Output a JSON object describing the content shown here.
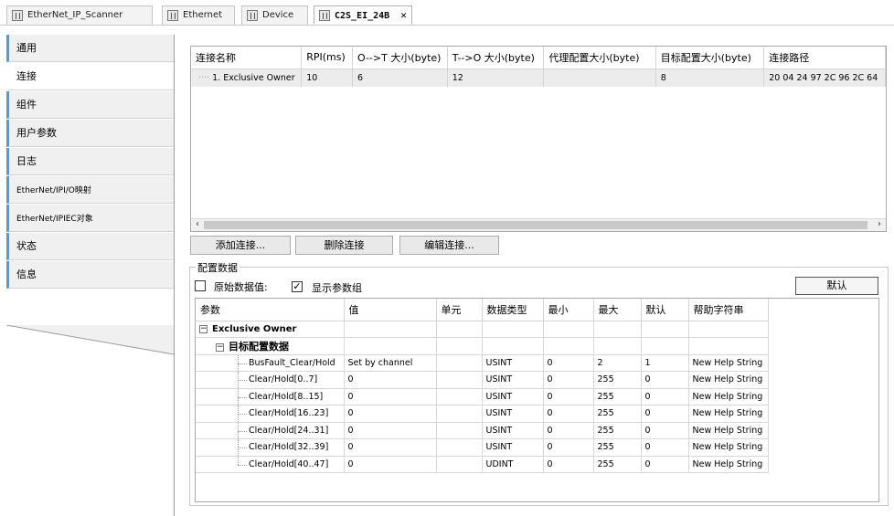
{
  "tabs": [
    {
      "label": "EtherNet_IP_Scanner",
      "active": false
    },
    {
      "label": "Ethernet",
      "active": false
    },
    {
      "label": "Device",
      "active": false
    },
    {
      "label": "C2S_EI_24B",
      "active": true
    }
  ],
  "nav": {
    "items": [
      {
        "label": "通用",
        "selected": false
      },
      {
        "label": "连接",
        "selected": true
      },
      {
        "label": "组件",
        "selected": false
      },
      {
        "label": "用户参数",
        "selected": false
      },
      {
        "label": "日志",
        "selected": false
      },
      {
        "label": "EtherNet/IPI/O映射",
        "selected": false
      },
      {
        "label": "EtherNet/IPIEC对象",
        "selected": false
      },
      {
        "label": "状态",
        "selected": false
      },
      {
        "label": "信息",
        "selected": false
      }
    ],
    "accent_color": "#4a9fe0"
  },
  "connections": {
    "headers": [
      "连接名称",
      "RPI(ms)",
      "O-->T 大小(byte)",
      "T-->O 大小(byte)",
      "代理配置大小(byte)",
      "目标配置大小(byte)",
      "连接路径"
    ],
    "rows": [
      [
        "1. Exclusive Owner",
        "10",
        "6",
        "12",
        "",
        "8",
        "20 04 24 97 2C 96 2C 64"
      ]
    ]
  },
  "buttons": {
    "add": "添加连接...",
    "delete": "删除连接",
    "edit": "编辑连接..."
  },
  "config": {
    "group_label": "配置数据",
    "raw_values_label": "原始数据值:",
    "raw_values_checked": false,
    "show_groups_label": "显示参数组",
    "show_groups_checked": true,
    "default_button": "默认",
    "headers": [
      "参数",
      "值",
      "单元",
      "数据类型",
      "最小",
      "最大",
      "默认",
      "帮助字符串"
    ],
    "group1": "Exclusive Owner",
    "group2": "目标配置数据",
    "rows": [
      {
        "param": "BusFault_Clear/Hold",
        "value": "Set by channel",
        "unit": "",
        "type": "USINT",
        "min": "0",
        "max": "2",
        "def": "1",
        "help": "New Help String"
      },
      {
        "param": "Clear/Hold[0..7]",
        "value": "0",
        "unit": "",
        "type": "USINT",
        "min": "0",
        "max": "255",
        "def": "0",
        "help": "New Help String"
      },
      {
        "param": "Clear/Hold[8..15]",
        "value": "0",
        "unit": "",
        "type": "USINT",
        "min": "0",
        "max": "255",
        "def": "0",
        "help": "New Help String"
      },
      {
        "param": "Clear/Hold[16..23]",
        "value": "0",
        "unit": "",
        "type": "USINT",
        "min": "0",
        "max": "255",
        "def": "0",
        "help": "New Help String"
      },
      {
        "param": "Clear/Hold[24..31]",
        "value": "0",
        "unit": "",
        "type": "USINT",
        "min": "0",
        "max": "255",
        "def": "0",
        "help": "New Help String"
      },
      {
        "param": "Clear/Hold[32..39]",
        "value": "0",
        "unit": "",
        "type": "USINT",
        "min": "0",
        "max": "255",
        "def": "0",
        "help": "New Help String"
      },
      {
        "param": "Clear/Hold[40..47]",
        "value": "0",
        "unit": "",
        "type": "UDINT",
        "min": "0",
        "max": "255",
        "def": "0",
        "help": "New Help String"
      }
    ]
  }
}
